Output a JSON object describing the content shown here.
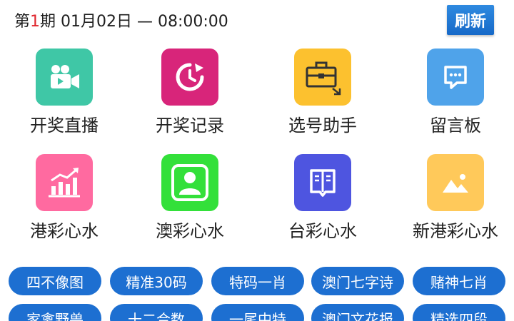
{
  "header": {
    "period_prefix": "第",
    "period_num": "1",
    "period_rest": "期 01月02日 — 08:00:00",
    "refresh_label": "刷新"
  },
  "grid": [
    {
      "label": "开奖直播",
      "icon": "video-camera-icon",
      "color": "#3fc7a6"
    },
    {
      "label": "开奖记录",
      "icon": "clock-refresh-icon",
      "color": "#d8257a"
    },
    {
      "label": "选号助手",
      "icon": "toolbox-icon",
      "color": "#fcc12f"
    },
    {
      "label": "留言板",
      "icon": "chat-bubble-icon",
      "color": "#4fa3ea"
    },
    {
      "label": "港彩心水",
      "icon": "bar-chart-icon",
      "color": "#ff6aa0"
    },
    {
      "label": "澳彩心水",
      "icon": "user-icon",
      "color": "#33e03a"
    },
    {
      "label": "台彩心水",
      "icon": "book-icon",
      "color": "#4e55e0"
    },
    {
      "label": "新港彩心水",
      "icon": "image-icon",
      "color": "#ffc95a"
    }
  ],
  "chips": [
    {
      "label": "四不像图"
    },
    {
      "label": "精准30码"
    },
    {
      "label": "特码一肖"
    },
    {
      "label": "澳门七字诗"
    },
    {
      "label": "赌神七肖"
    },
    {
      "label": "家禽野兽"
    },
    {
      "label": "十二合数"
    },
    {
      "label": "一尾中特"
    },
    {
      "label": "澳门文花报"
    },
    {
      "label": "精选四段"
    }
  ]
}
